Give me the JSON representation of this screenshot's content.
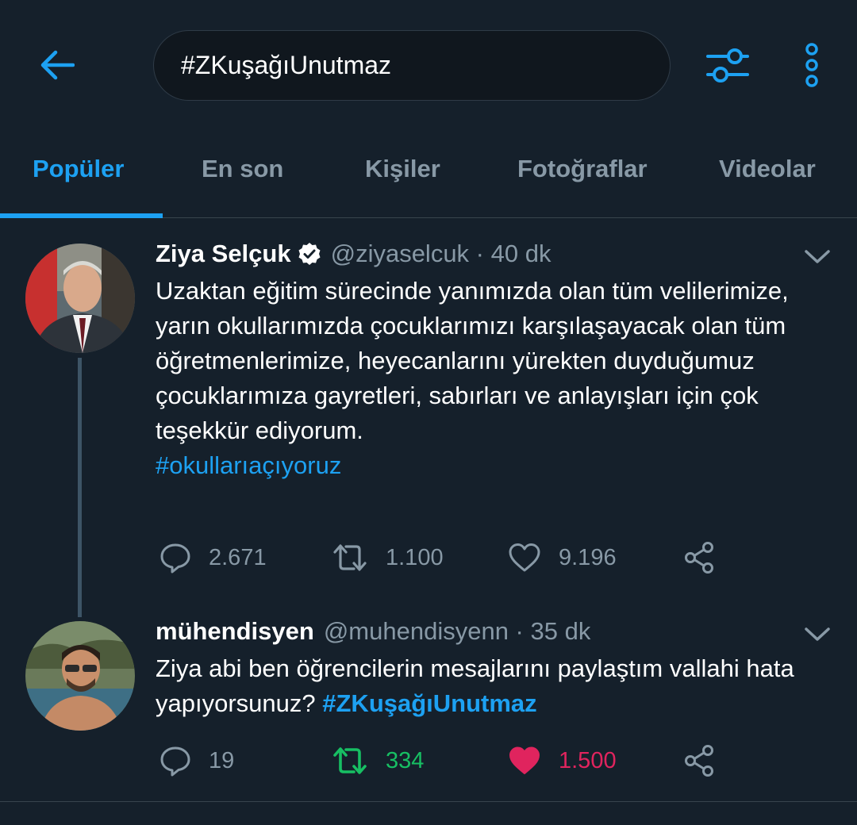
{
  "search": {
    "query": "#ZKuşağıUnutmaz"
  },
  "tabs": [
    {
      "label": "Popüler",
      "active": true
    },
    {
      "label": "En son",
      "active": false
    },
    {
      "label": "Kişiler",
      "active": false
    },
    {
      "label": "Fotoğraflar",
      "active": false
    },
    {
      "label": "Videolar",
      "active": false
    }
  ],
  "tweets": [
    {
      "name": "Ziya Selçuk",
      "verified": true,
      "handle_time": "@ziyaselcuk · 40 dk",
      "text": "Uzaktan eğitim sürecinde yanımızda olan tüm velilerimize, yarın okullarımızda çocuklarımızı karşılaşayacak olan tüm öğretmenlerimize, heyecanlarını yürekten duyduğumuz çocuklarımıza gayretleri, sabırları ve anlayışları için çok teşekkür ediyorum.",
      "hashtag": "#okullarıaçıyoruz",
      "replies": "2.671",
      "retweets": "1.100",
      "likes": "9.196"
    },
    {
      "name": "mühendisyen",
      "verified": false,
      "handle_time": "@muhendisyenn · 35 dk",
      "text": "Ziya abi ben öğrencilerin mesajlarını paylaştım vallahi hata yapıyorsunuz?",
      "hashtag": "#ZKuşağıUnutmaz",
      "replies": "19",
      "retweets": "334",
      "likes": "1.500"
    }
  ],
  "colors": {
    "background": "#15202b",
    "accent": "#1da1f2",
    "secondary_text": "#8899a6",
    "retweet_active": "#17bf63",
    "like_active": "#e0245e"
  }
}
